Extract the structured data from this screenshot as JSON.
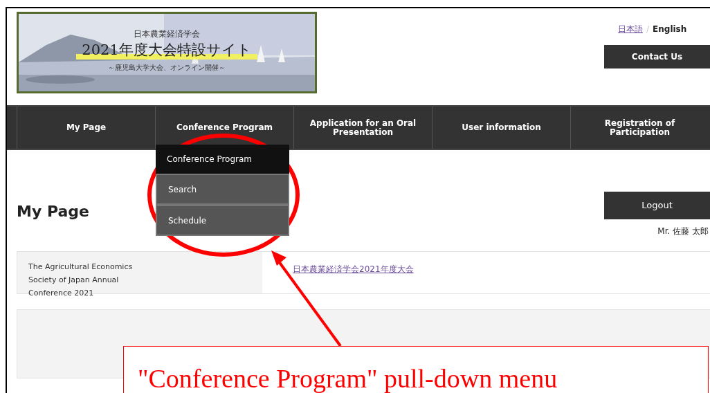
{
  "header": {
    "banner": {
      "society": "日本農業経済学会",
      "title": "2021年度大会特設サイト",
      "subtitle": "～鹿児島大学大会、オンライン開催～"
    },
    "languages": [
      {
        "label": "日本語",
        "selected": false
      },
      {
        "label": "English",
        "selected": true
      }
    ],
    "separator": "/",
    "contact_button": "Contact Us"
  },
  "nav": [
    {
      "label": "My Page"
    },
    {
      "label": "Conference Program",
      "menu": [
        {
          "label": "Conference Program",
          "selected": true
        },
        {
          "label": "Search",
          "selected": false
        },
        {
          "label": "Schedule",
          "selected": false
        }
      ]
    },
    {
      "label": "Application for an Oral Presentation"
    },
    {
      "label": "User information"
    },
    {
      "label": "Registration of Participation"
    }
  ],
  "page_title": "My Page",
  "logout_button": "Logout",
  "user_name": "Mr. 佐藤 太郎",
  "conference": {
    "label": "The Agricultural Economics Society of Japan Annual Conference 2021",
    "link": "日本農業経済学会2021年度大会"
  },
  "annotation": {
    "text": "\"Conference Program\" pull-down menu"
  }
}
